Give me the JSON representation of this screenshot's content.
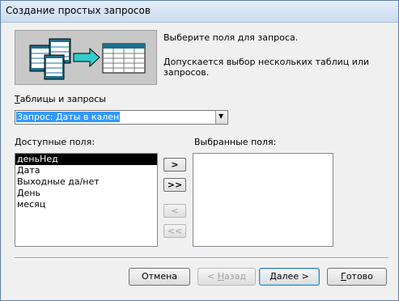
{
  "window": {
    "title": "Создание простых запросов"
  },
  "intro": {
    "line1": "Выберите поля для запроса.",
    "line2": "Допускается выбор нескольких таблиц или запросов."
  },
  "tables": {
    "label": "Таблицы и запросы",
    "label_hotkey": "Т",
    "label_rest": "аблицы и запросы",
    "selected": "Запрос: Даты в кален"
  },
  "available": {
    "label_hotkey": "Д",
    "label_rest": "оступные поля:",
    "items": [
      "деньНед",
      "Дата",
      "Выходные да/нет",
      "День",
      "месяц"
    ],
    "selected_index": 0
  },
  "selected_fields": {
    "label": "Выбранные поля:",
    "items": []
  },
  "move_buttons": {
    "add_one": ">",
    "add_all": ">>",
    "remove_one": "<",
    "remove_all": "<<"
  },
  "footer": {
    "cancel": "Отмена",
    "back_prefix": "< ",
    "back_hotkey": "Н",
    "back_rest": "азад",
    "next_hotkey": "Д",
    "next_rest": "алее >",
    "finish_hotkey": "Г",
    "finish_rest": "отово"
  }
}
